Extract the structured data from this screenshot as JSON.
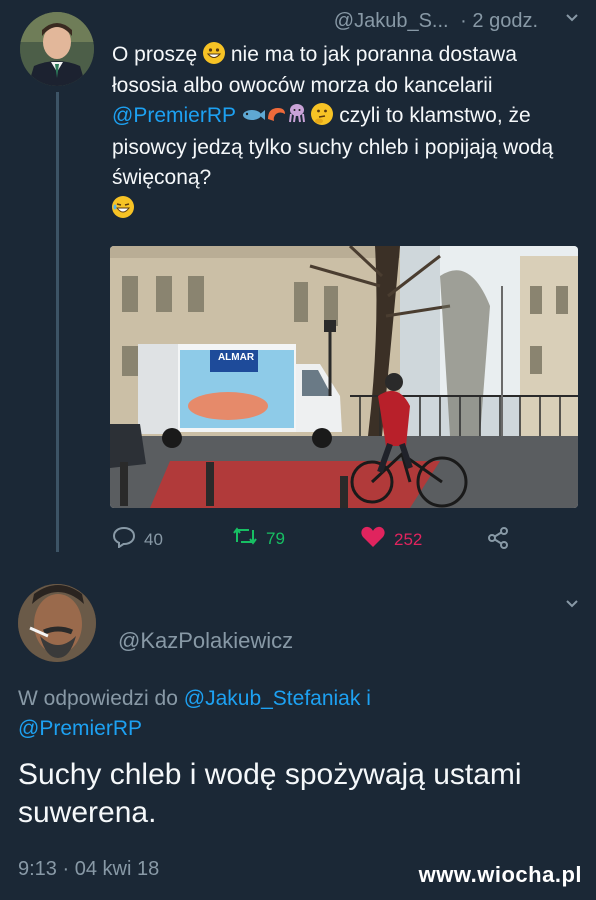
{
  "tweet": {
    "handle_truncated": "@Jakub_S...",
    "time_ago": "· 2 godz.",
    "text_before_emoji": "O proszę ",
    "text_after_emoji": " nie ma to jak poranna dostawa łososia albo owoców morza do kancelarii ",
    "mention": "@PremierRP",
    "text_tail": " czyli to klamstwo, że pisowcy jedzą tylko suchy chleb i popijają wodą święconą?",
    "media_sign_text": "ALMAR",
    "actions": {
      "replies": "40",
      "retweets": "79",
      "likes": "252"
    }
  },
  "reply": {
    "handle": "@KazPolakiewicz",
    "in_reply_prefix": "W odpowiedzi do ",
    "in_reply_mention_1": "@Jakub_Stefaniak",
    "in_reply_joiner": " i",
    "in_reply_mention_2": "@PremierRP",
    "text": "Suchy chleb i wodę spożywają ustami suwerena.",
    "timestamp": "9:13 · 04 kwi 18"
  },
  "watermark": "www.wiocha.pl",
  "icons": [
    "chevron-down-icon",
    "reply-icon",
    "retweet-icon",
    "heart-icon",
    "share-icon"
  ],
  "colors": {
    "background": "#1b2836",
    "link": "#1da1f2",
    "muted": "#8899a6",
    "retweet": "#17bf63",
    "like": "#e0245e"
  }
}
